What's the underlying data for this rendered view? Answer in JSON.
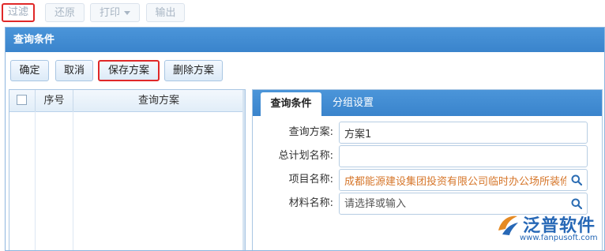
{
  "toolbar": {
    "filter": "过滤",
    "restore": "还原",
    "print": "打印",
    "export": "输出"
  },
  "dialog": {
    "title": "查询条件",
    "actions": {
      "confirm": "确定",
      "cancel": "取消",
      "save_scheme": "保存方案",
      "delete_scheme": "删除方案"
    }
  },
  "grid": {
    "columns": [
      "序号",
      "查询方案"
    ],
    "rows": []
  },
  "tabs": [
    "查询条件",
    "分组设置"
  ],
  "form": {
    "scheme": {
      "label": "查询方案:",
      "value": "方案1"
    },
    "plan_name": {
      "label": "总计划名称:",
      "value": ""
    },
    "project_name": {
      "label": "项目名称:",
      "value": "成都能源建设集团投资有限公司临时办公场所装修"
    },
    "material_name": {
      "label": "材料名称:",
      "value": "",
      "placeholder": "请选择或输入"
    }
  },
  "brand": {
    "name": "泛普软件",
    "url": "www.fanpusoft.com"
  },
  "colors": {
    "header_blue": "#3a84cc",
    "highlight_red": "#e02828",
    "value_orange": "#d6762a",
    "brand_blue": "#2768b6"
  }
}
